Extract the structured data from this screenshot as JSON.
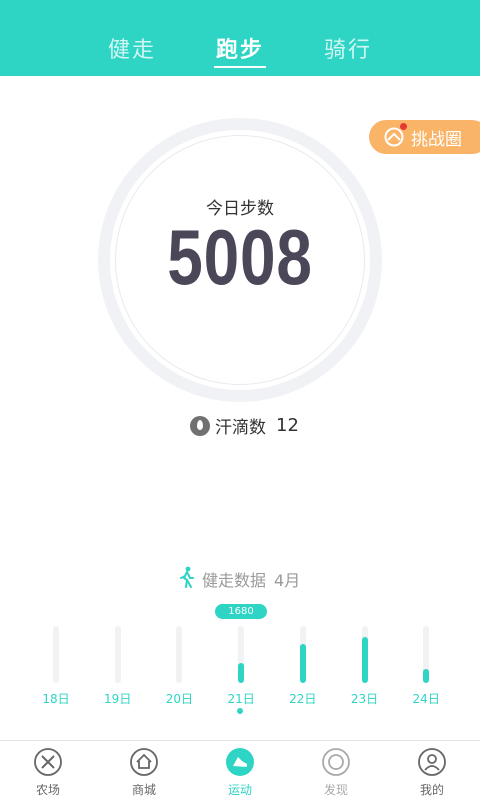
{
  "header": {
    "tabs": [
      {
        "label": "健走"
      },
      {
        "label": "跑步"
      },
      {
        "label": "骑行"
      }
    ],
    "active_tab": "跑步"
  },
  "challenge": {
    "label": "挑战圈"
  },
  "steps": {
    "label": "今日步数",
    "value": "5008"
  },
  "sweat": {
    "label": "汗滴数",
    "value": "12"
  },
  "walking_data": {
    "title": "健走数据",
    "month": "4月"
  },
  "chart_data": {
    "type": "bar",
    "categories": [
      "18日",
      "19日",
      "20日",
      "21日",
      "22日",
      "23日",
      "24日"
    ],
    "values": [
      0,
      0,
      0,
      1680,
      3300,
      3900,
      1150
    ],
    "ylim": [
      0,
      4800
    ],
    "selected_index": 3,
    "selected_label": "1680",
    "color": "#2ED4C4"
  },
  "nav": {
    "items": [
      {
        "label": "农场"
      },
      {
        "label": "商城"
      },
      {
        "label": "运动"
      },
      {
        "label": "发现"
      },
      {
        "label": "我的"
      }
    ]
  },
  "colors": {
    "accent": "#2ED4C4",
    "challenge": "#F9B468",
    "steps_text": "#4C4758"
  }
}
